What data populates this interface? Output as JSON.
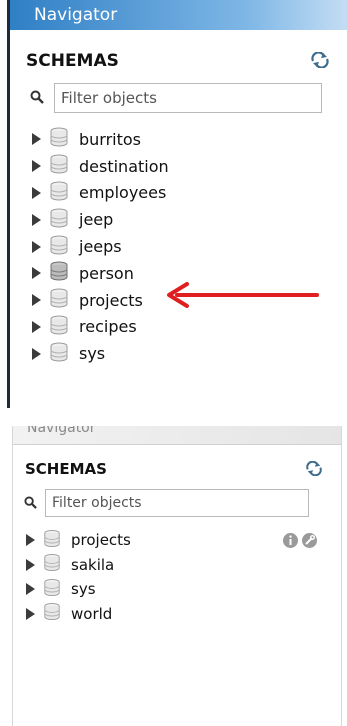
{
  "top": {
    "title": "Navigator",
    "schemas_title": "SCHEMAS",
    "filter_placeholder": "Filter objects",
    "items": [
      {
        "label": "burritos"
      },
      {
        "label": "destination"
      },
      {
        "label": "employees"
      },
      {
        "label": "jeep"
      },
      {
        "label": "jeeps"
      },
      {
        "label": "person"
      },
      {
        "label": "projects"
      },
      {
        "label": "recipes"
      },
      {
        "label": "sys"
      }
    ]
  },
  "bottom": {
    "title": "Navigator",
    "schemas_title": "SCHEMAS",
    "filter_placeholder": "Filter objects",
    "items": [
      {
        "label": "projects"
      },
      {
        "label": "sakila"
      },
      {
        "label": "sys"
      },
      {
        "label": "world"
      }
    ]
  },
  "colors": {
    "header_blue": "#2f7fc5",
    "annotation_red": "#e02020"
  },
  "icons": {
    "refresh": "refresh-icon",
    "search": "search-icon",
    "expand": "expand-arrow-icon",
    "database": "database-icon",
    "info": "info-icon",
    "wrench": "wrench-icon",
    "annotation": "red-arrow-icon"
  }
}
